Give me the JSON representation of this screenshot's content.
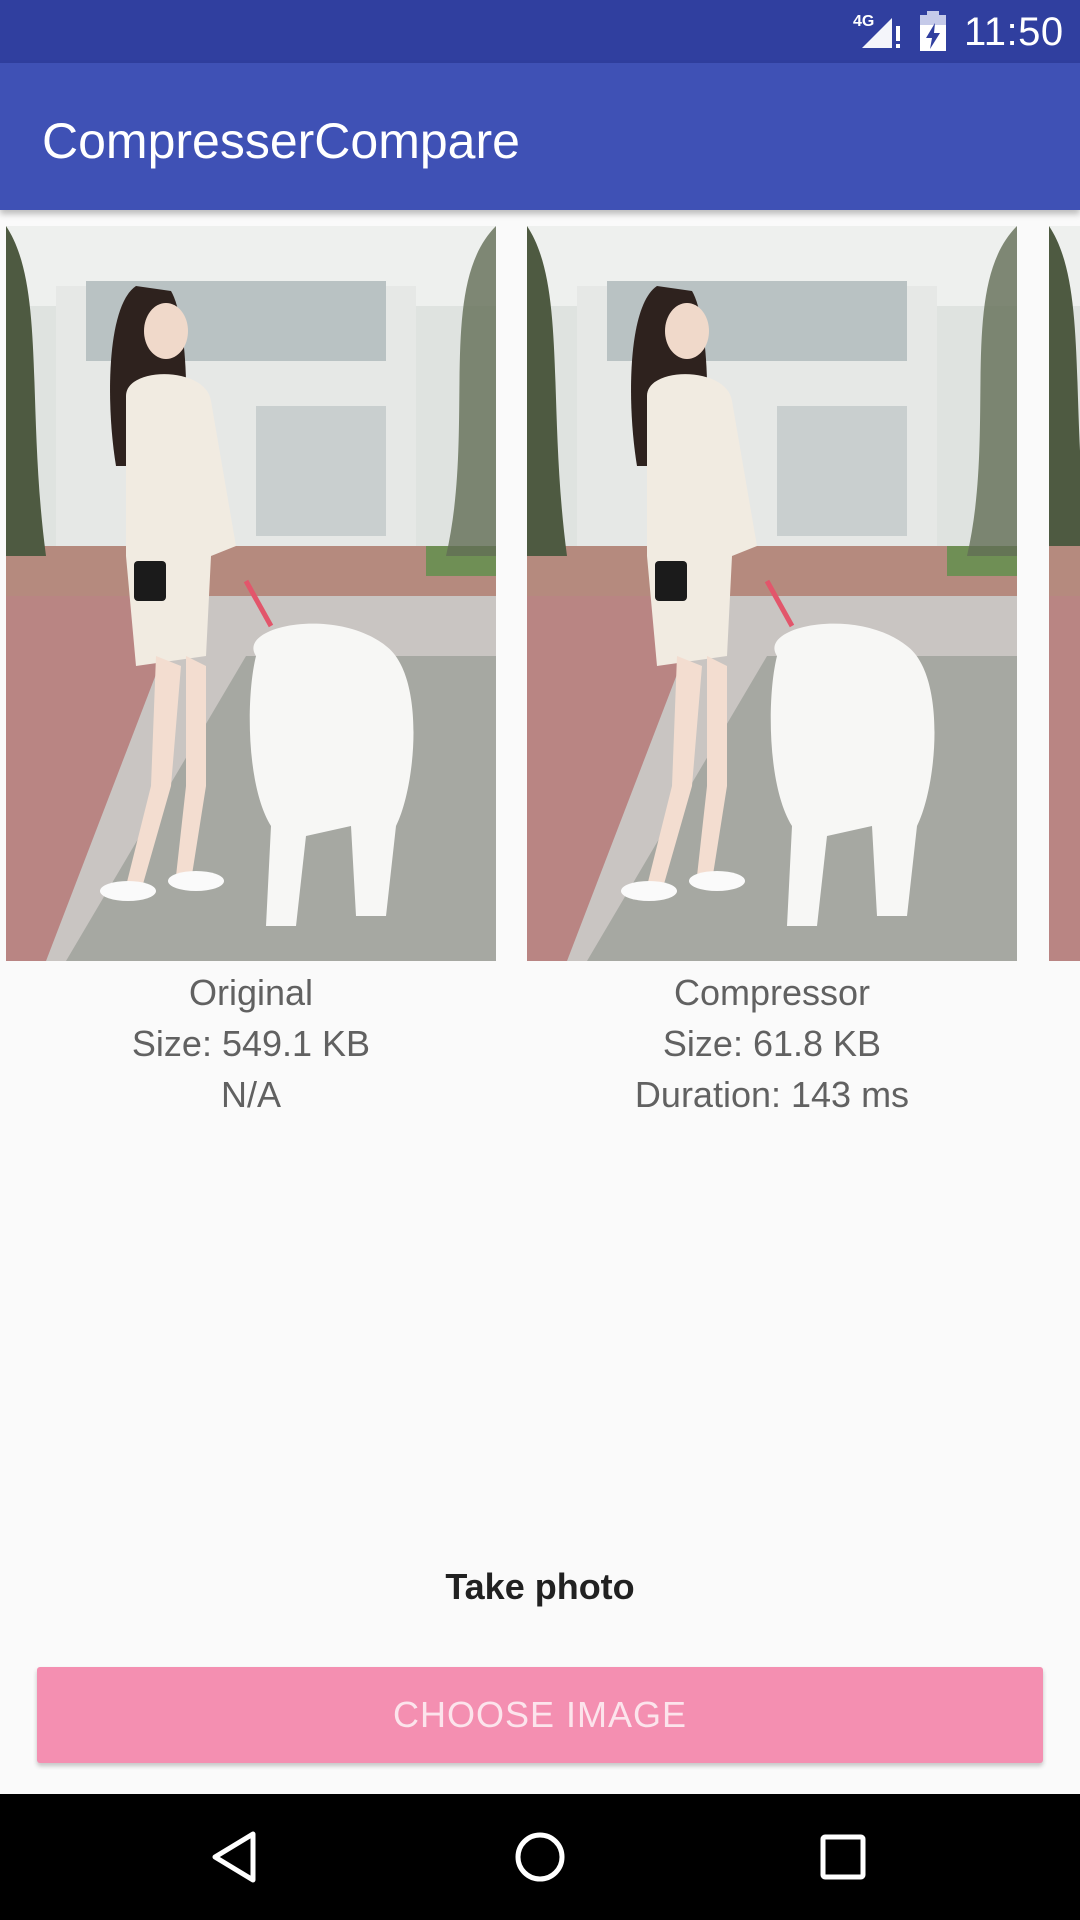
{
  "status_bar": {
    "network": "4G",
    "network_icon": "signal-4g-icon",
    "battery_icon": "battery-charging-icon",
    "time": "11:50"
  },
  "app_bar": {
    "title": "CompresserCompare"
  },
  "results": [
    {
      "title": "Original",
      "size": "Size: 549.1 KB",
      "detail": "N/A"
    },
    {
      "title": "Compressor",
      "size": "Size: 61.8 KB",
      "detail": "Duration: 143 ms"
    }
  ],
  "actions": {
    "take_photo": "Take photo",
    "choose_image": "CHOOSE IMAGE"
  },
  "colors": {
    "status_bar": "#303f9f",
    "app_bar": "#3f51b5",
    "button": "#f48fb1",
    "button_text": "#fce4ec"
  },
  "nav_bar": {
    "icons": [
      "back-icon",
      "home-icon",
      "recents-icon"
    ]
  }
}
